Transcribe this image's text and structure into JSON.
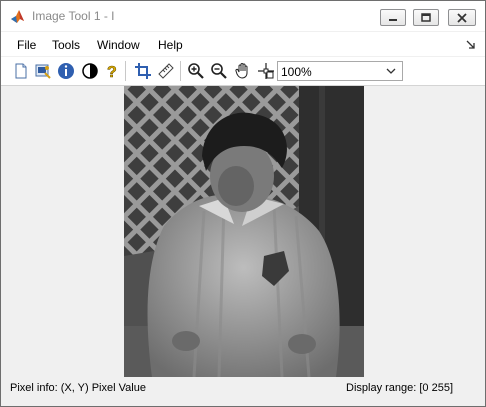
{
  "window": {
    "title": "Image Tool 1 - I"
  },
  "menubar": {
    "items": [
      "File",
      "Tools",
      "Window",
      "Help"
    ]
  },
  "toolbar": {
    "buttons": [
      "new-figure-icon",
      "export-image-icon",
      "image-info-icon",
      "adjust-contrast-icon",
      "help-icon",
      "crop-icon",
      "distance-tool-icon",
      "zoom-in-icon",
      "zoom-out-icon",
      "pan-icon",
      "pixel-region-icon"
    ],
    "zoom_value": "100%"
  },
  "image": {
    "description_icon": "grayscale-photo"
  },
  "statusbar": {
    "pixel_info": "Pixel info: (X, Y)  Pixel Value",
    "display_range": "Display range: [0 255]"
  },
  "colors": {
    "title_text": "#8a8a8a",
    "chrome": "#f0f0f0"
  }
}
